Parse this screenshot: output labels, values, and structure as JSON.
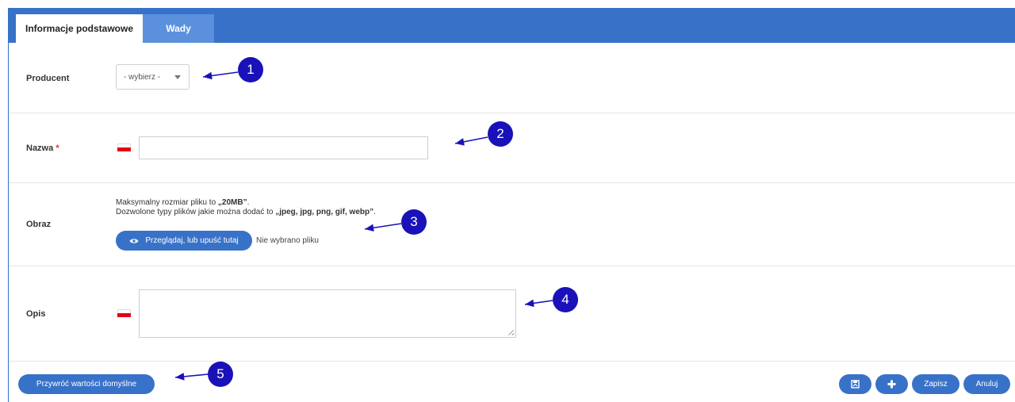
{
  "tabs": [
    {
      "label": "Informacje podstawowe",
      "active": true
    },
    {
      "label": "Wady",
      "active": false
    }
  ],
  "form": {
    "producent": {
      "label": "Producent",
      "select_value": "- wybierz -"
    },
    "nazwa": {
      "label": "Nazwa",
      "required_mark": "*",
      "value": ""
    },
    "obraz": {
      "label": "Obraz",
      "info_line1_prefix": "Maksymalny rozmiar pliku to ",
      "info_line1_value": "„20MB”",
      "info_line1_suffix": ".",
      "info_line2_prefix": "Dozwolone typy plików jakie można dodać to ",
      "info_line2_value": "„jpeg, jpg, png, gif, webp”",
      "info_line2_suffix": ".",
      "browse_label": "Przeglądaj, lub upuść tutaj",
      "no_file_text": "Nie wybrano pliku"
    },
    "opis": {
      "label": "Opis",
      "value": ""
    }
  },
  "footer": {
    "restore_label": "Przywróć wartości domyślne",
    "save_label": "Zapisz",
    "cancel_label": "Anuluj"
  },
  "annotations": [
    "1",
    "2",
    "3",
    "4",
    "5"
  ],
  "colors": {
    "primary": "#3872c8",
    "tab_inactive": "#5b91dc",
    "marker": "#1a12b8",
    "required": "#e03030",
    "flag_red": "#e3001b"
  },
  "icons": [
    "eye-icon",
    "save-back-icon",
    "plus-icon",
    "chevron-down-icon",
    "flag-pl-icon"
  ]
}
